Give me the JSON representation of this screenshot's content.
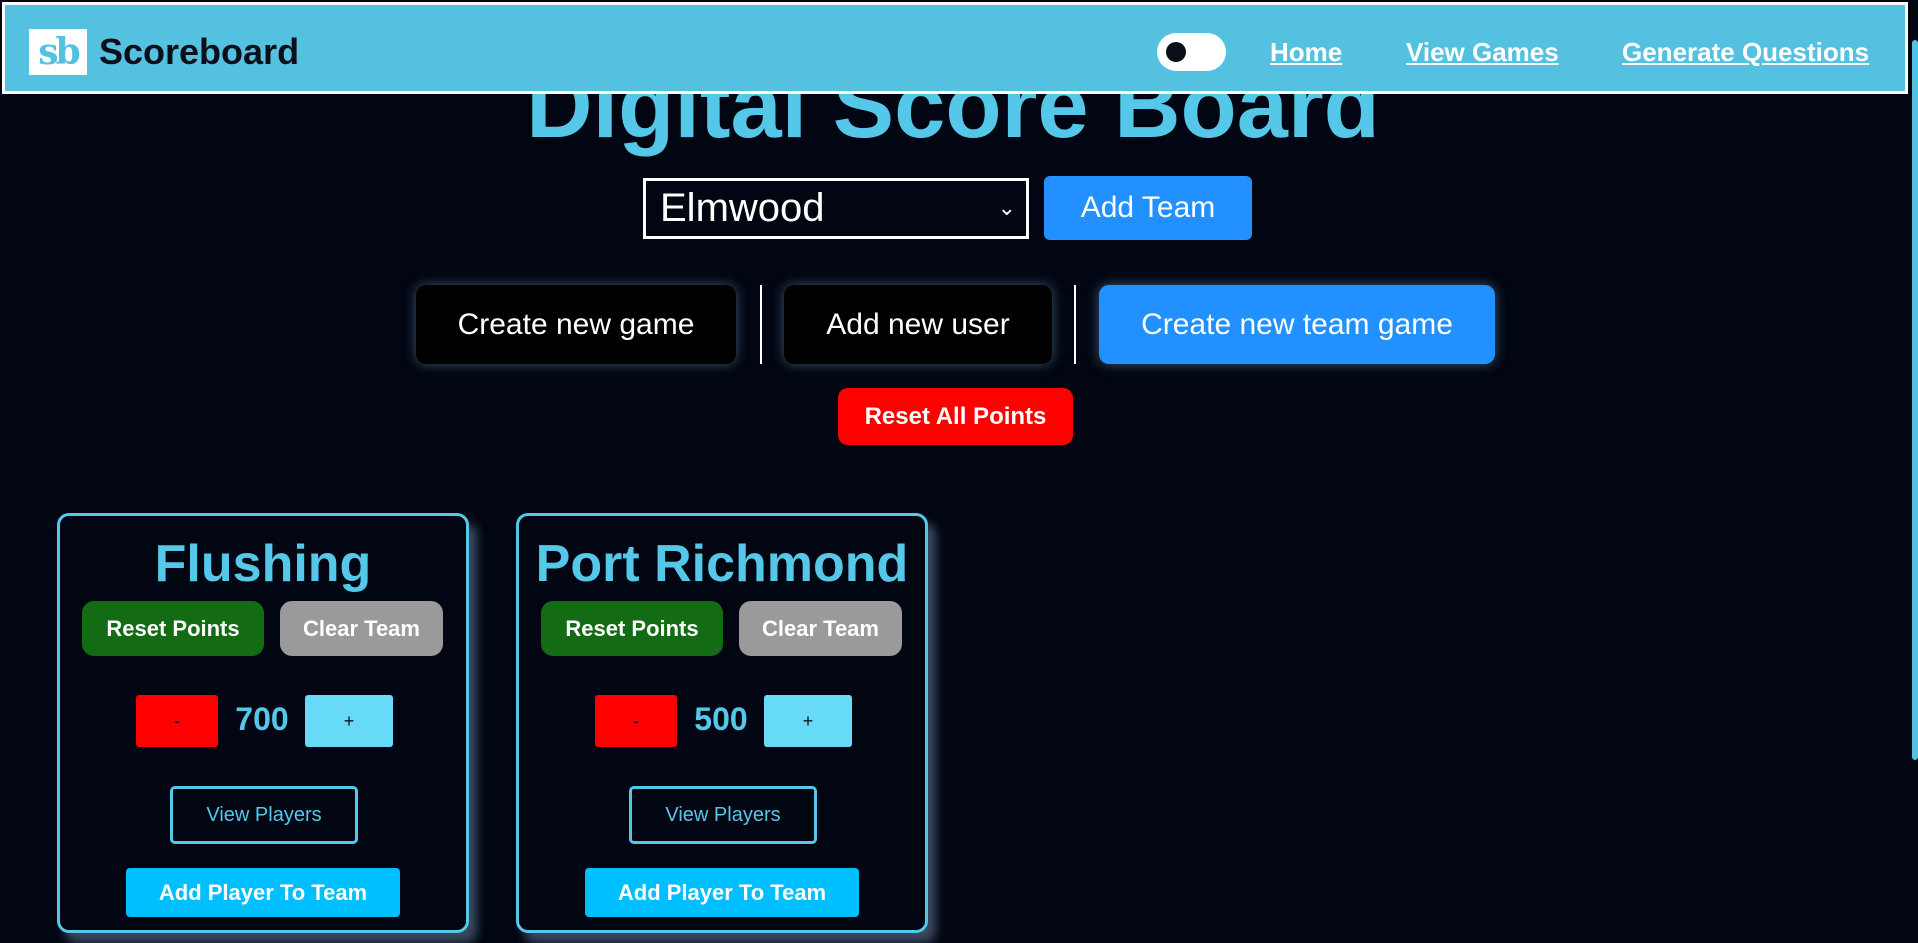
{
  "navbar": {
    "brand_logo_text": "sb",
    "brand_name": "Scoreboard",
    "links": {
      "home": "Home",
      "view_games": "View Games",
      "generate_questions": "Generate Questions"
    }
  },
  "header": {
    "title": "Digital Score Board"
  },
  "team_selector": {
    "selected": "Elmwood",
    "add_team_label": "Add Team"
  },
  "actions": {
    "create_game": "Create new game",
    "add_user": "Add new user",
    "create_team_game": "Create new team game",
    "reset_all": "Reset All Points"
  },
  "teams": [
    {
      "name": "Flushing",
      "reset_label": "Reset Points",
      "clear_label": "Clear Team",
      "minus_label": "-",
      "score": "700",
      "plus_label": "+",
      "view_players_label": "View Players",
      "add_player_label": "Add Player To Team"
    },
    {
      "name": "Port Richmond",
      "reset_label": "Reset Points",
      "clear_label": "Clear Team",
      "minus_label": "-",
      "score": "500",
      "plus_label": "+",
      "view_players_label": "View Players",
      "add_player_label": "Add Player To Team"
    }
  ],
  "colors": {
    "navbar_bg": "#55c1e0",
    "page_bg": "#010612",
    "accent_cyan": "#55c8ea",
    "primary_blue": "#2291ff",
    "danger_red": "#ff0000",
    "success_green": "#136b13",
    "neutral_gray": "#9a9a9a"
  }
}
